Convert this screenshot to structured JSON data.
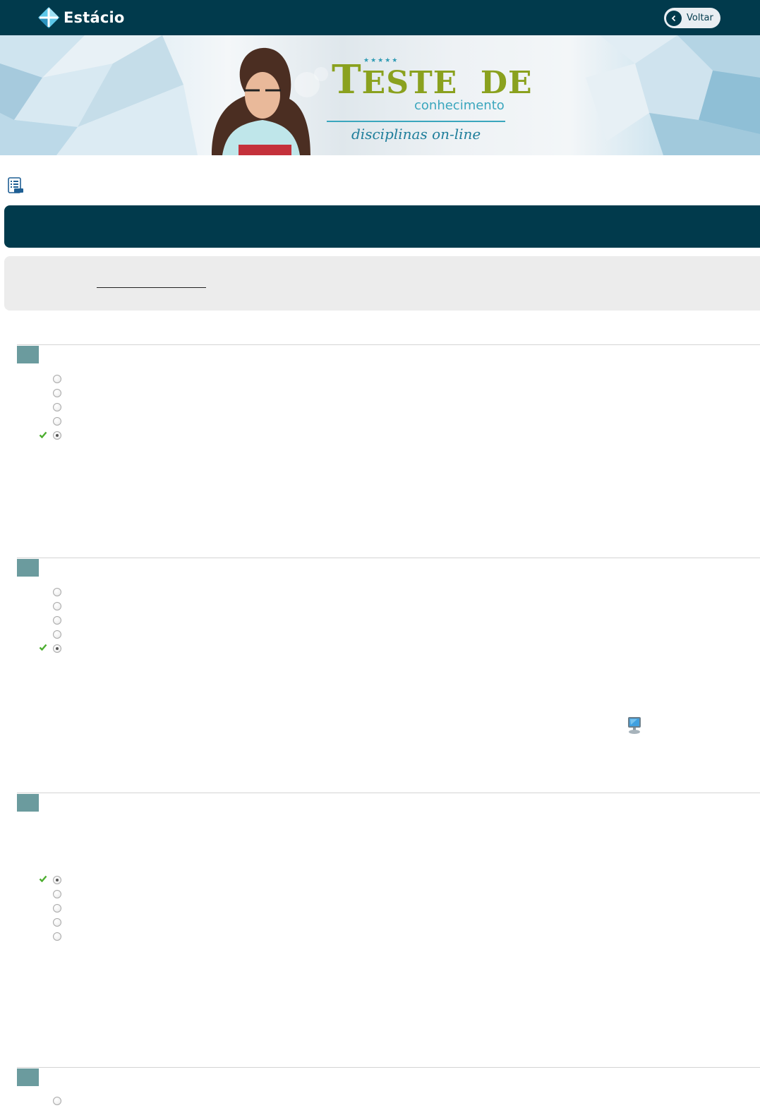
{
  "header": {
    "brand_name": "Estácio",
    "back_label": "Voltar"
  },
  "banner": {
    "title_initial": "T",
    "title_rest": "ESTE  DE",
    "stars": "★★★★★",
    "subtitle": "conhecimento",
    "tagline": "disciplinas on-line"
  },
  "questions": [
    {
      "options": 5,
      "correct_index": 4,
      "selected_index": 4
    },
    {
      "options": 5,
      "correct_index": 4,
      "selected_index": 4
    },
    {
      "options": 5,
      "correct_index": 0,
      "selected_index": 0
    },
    {
      "options": 1,
      "correct_index": null,
      "selected_index": null
    }
  ],
  "colors": {
    "header_bg": "#013a4c",
    "badge": "#6b9b9e",
    "info_box": "#ececec",
    "brand_green": "#8aa11e",
    "accent_blue": "#3aa6bd",
    "check_green": "#4cae2f"
  },
  "icons": {
    "brand": "estacio-logo-icon",
    "back": "chevron-left-icon",
    "page": "document-list-icon",
    "correct": "checkmark-icon",
    "resource": "monitor-icon"
  }
}
